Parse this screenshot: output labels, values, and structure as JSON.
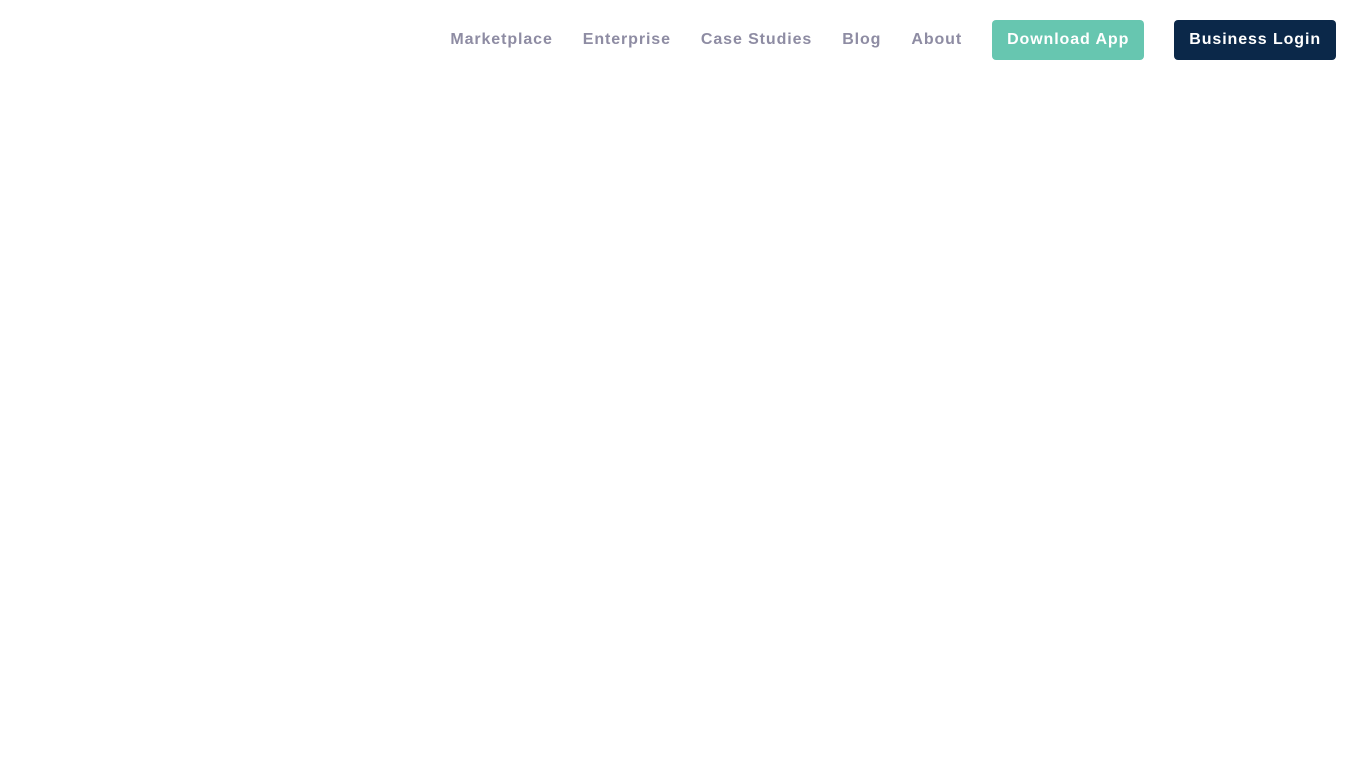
{
  "navbar": {
    "links": [
      {
        "label": "Marketplace"
      },
      {
        "label": "Enterprise"
      },
      {
        "label": "Case Studies"
      },
      {
        "label": "Blog"
      },
      {
        "label": "About"
      }
    ],
    "download_button": {
      "label": "Download App",
      "color": "#67c6b0"
    },
    "login_button": {
      "label": "Business Login",
      "color": "#0b2849"
    },
    "link_color": "#8e8ca3"
  }
}
